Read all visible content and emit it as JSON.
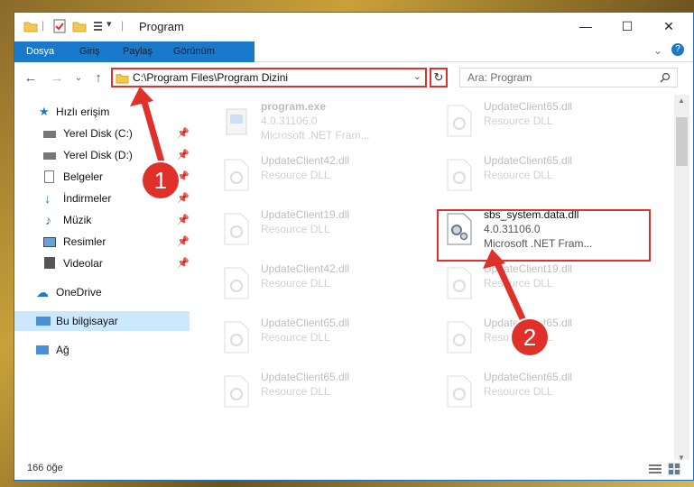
{
  "window": {
    "title": "Program"
  },
  "title_buttons": {
    "minimize": "—",
    "maximize": "☐",
    "close": "✕"
  },
  "ribbon": {
    "tabs": [
      "Dosya",
      "Giriş",
      "Paylaş",
      "Görünüm"
    ],
    "help": "?"
  },
  "address": {
    "path": "C:\\Program Files\\Program Dizini",
    "refresh": "↻"
  },
  "search": {
    "placeholder": "Ara: Program"
  },
  "nav": {
    "items": [
      {
        "label": "Hızlı erişim",
        "icon": "star-icon"
      },
      {
        "label": "Yerel Disk (C:)",
        "icon": "drive-icon",
        "pinned": true
      },
      {
        "label": "Yerel Disk (D:)",
        "icon": "drive-icon",
        "pinned": true
      },
      {
        "label": "Belgeler",
        "icon": "document-icon",
        "pinned": true
      },
      {
        "label": "İndirmeler",
        "icon": "download-icon",
        "pinned": true
      },
      {
        "label": "Müzik",
        "icon": "music-icon",
        "pinned": true
      },
      {
        "label": "Resimler",
        "icon": "pictures-icon",
        "pinned": true
      },
      {
        "label": "Videolar",
        "icon": "video-icon",
        "pinned": true
      },
      {
        "label": "OneDrive",
        "icon": "cloud-icon"
      },
      {
        "label": "Bu bilgisayar",
        "icon": "computer-icon",
        "selected": true
      },
      {
        "label": "Ağ",
        "icon": "network-icon"
      }
    ],
    "pin_glyph": "📌"
  },
  "files": [
    {
      "name": "program.exe",
      "line2": "4.0.31106.0",
      "line3": "Microsoft .NET Fram..."
    },
    {
      "name": "UpdateClient65.dll",
      "line2": "Resource DLL"
    },
    {
      "name": "UpdateClient42.dll",
      "line2": "Resource DLL"
    },
    {
      "name": "UpdateClient65.dll",
      "line2": "Resource DLL"
    },
    {
      "name": "UpdateClient19.dll",
      "line2": "Resource DLL"
    },
    {
      "name": "sbs_system.data.dll",
      "line2": "4.0.31106.0",
      "line3": "Microsoft .NET Fram...",
      "highlighted": true
    },
    {
      "name": "UpdateClient42.dll",
      "line2": "Resource DLL"
    },
    {
      "name": "UpdateClient19.dll",
      "line2": "Resource DLL"
    },
    {
      "name": "UpdateClient65.dll",
      "line2": "Resource DLL"
    },
    {
      "name": "UpdateClient65.dll",
      "line2": "Resource DLL"
    },
    {
      "name": "UpdateClient65.dll",
      "line2": "Resource DLL"
    },
    {
      "name": "UpdateClient65.dll",
      "line2": "Resource DLL"
    }
  ],
  "status": {
    "count": "166 öğe"
  },
  "annotations": {
    "badge1": "1",
    "badge2": "2"
  },
  "colors": {
    "accent": "#1979ca",
    "highlight": "#e0302a",
    "selected": "#cce8ff"
  }
}
